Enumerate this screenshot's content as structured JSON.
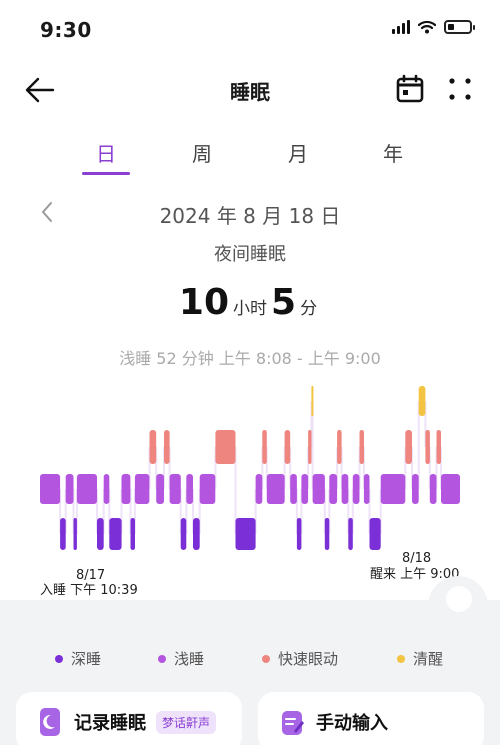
{
  "status_bar": {
    "time": "9:30"
  },
  "header": {
    "title": "睡眠",
    "back_icon": "arrow-left-icon",
    "calendar_icon": "calendar-icon",
    "more_icon": "more-dots-icon"
  },
  "tabs": [
    {
      "label": "日",
      "active": true
    },
    {
      "label": "周",
      "active": false
    },
    {
      "label": "月",
      "active": false
    },
    {
      "label": "年",
      "active": false
    }
  ],
  "date": {
    "text": "2024 年 8 月 18 日",
    "prev_icon": "chevron-left-icon"
  },
  "summary": {
    "subtitle": "夜间睡眠",
    "hours": "10",
    "hours_unit": "小时",
    "minutes": "5",
    "minutes_unit": "分",
    "stage_info": "浅睡 52 分钟 上午 8:08 - 上午 9:00"
  },
  "timeline": {
    "start_date": "8/17",
    "start_label": "入睡 下午 10:39",
    "end_date": "8/18",
    "end_label": "醒来 上午 9:00"
  },
  "legend": [
    {
      "label": "深睡",
      "color": "#7b2fd6"
    },
    {
      "label": "浅睡",
      "color": "#b455e0"
    },
    {
      "label": "快速眼动",
      "color": "#ee857f"
    },
    {
      "label": "清醒",
      "color": "#f3c442"
    }
  ],
  "colors": {
    "accent": "#8a3fd1",
    "deep": "#7b2fd6",
    "light": "#b455e0",
    "rem": "#ee857f",
    "awake": "#f3c442"
  },
  "actions": {
    "record": {
      "label": "记录睡眠",
      "badge": "梦话鼾声",
      "icon": "moon-phone-icon"
    },
    "manual": {
      "label": "手动输入",
      "icon": "edit-note-icon"
    }
  },
  "chart_data": {
    "type": "timeline",
    "levels": [
      "awake",
      "rem",
      "light",
      "deep"
    ],
    "segments": [
      {
        "stage": "light",
        "dur": 0.9
      },
      {
        "stage": "deep",
        "dur": 0.25
      },
      {
        "stage": "light",
        "dur": 0.35
      },
      {
        "stage": "deep",
        "dur": 0.15
      },
      {
        "stage": "light",
        "dur": 0.9
      },
      {
        "stage": "deep",
        "dur": 0.3
      },
      {
        "stage": "light",
        "dur": 0.25
      },
      {
        "stage": "deep",
        "dur": 0.55
      },
      {
        "stage": "light",
        "dur": 0.4
      },
      {
        "stage": "deep",
        "dur": 0.2
      },
      {
        "stage": "light",
        "dur": 0.65
      },
      {
        "stage": "rem",
        "dur": 0.3
      },
      {
        "stage": "light",
        "dur": 0.35
      },
      {
        "stage": "rem",
        "dur": 0.25
      },
      {
        "stage": "light",
        "dur": 0.5
      },
      {
        "stage": "deep",
        "dur": 0.25
      },
      {
        "stage": "light",
        "dur": 0.3
      },
      {
        "stage": "deep",
        "dur": 0.3
      },
      {
        "stage": "light",
        "dur": 0.7
      },
      {
        "stage": "rem",
        "dur": 0.9
      },
      {
        "stage": "deep",
        "dur": 0.9
      },
      {
        "stage": "light",
        "dur": 0.3
      },
      {
        "stage": "rem",
        "dur": 0.2
      },
      {
        "stage": "light",
        "dur": 0.8
      },
      {
        "stage": "rem",
        "dur": 0.25
      },
      {
        "stage": "light",
        "dur": 0.3
      },
      {
        "stage": "deep",
        "dur": 0.2
      },
      {
        "stage": "light",
        "dur": 0.3
      },
      {
        "stage": "rem",
        "dur": 0.15
      },
      {
        "stage": "awake",
        "dur": 0.05
      },
      {
        "stage": "light",
        "dur": 0.55
      },
      {
        "stage": "deep",
        "dur": 0.2
      },
      {
        "stage": "light",
        "dur": 0.35
      },
      {
        "stage": "rem",
        "dur": 0.2
      },
      {
        "stage": "light",
        "dur": 0.3
      },
      {
        "stage": "deep",
        "dur": 0.2
      },
      {
        "stage": "light",
        "dur": 0.3
      },
      {
        "stage": "rem",
        "dur": 0.2
      },
      {
        "stage": "light",
        "dur": 0.25
      },
      {
        "stage": "deep",
        "dur": 0.5
      },
      {
        "stage": "light",
        "dur": 1.1
      },
      {
        "stage": "rem",
        "dur": 0.3
      },
      {
        "stage": "light",
        "dur": 0.3
      },
      {
        "stage": "awake",
        "dur": 0.3
      },
      {
        "stage": "rem",
        "dur": 0.2
      },
      {
        "stage": "light",
        "dur": 0.3
      },
      {
        "stage": "rem",
        "dur": 0.2
      },
      {
        "stage": "light",
        "dur": 0.85
      }
    ]
  }
}
